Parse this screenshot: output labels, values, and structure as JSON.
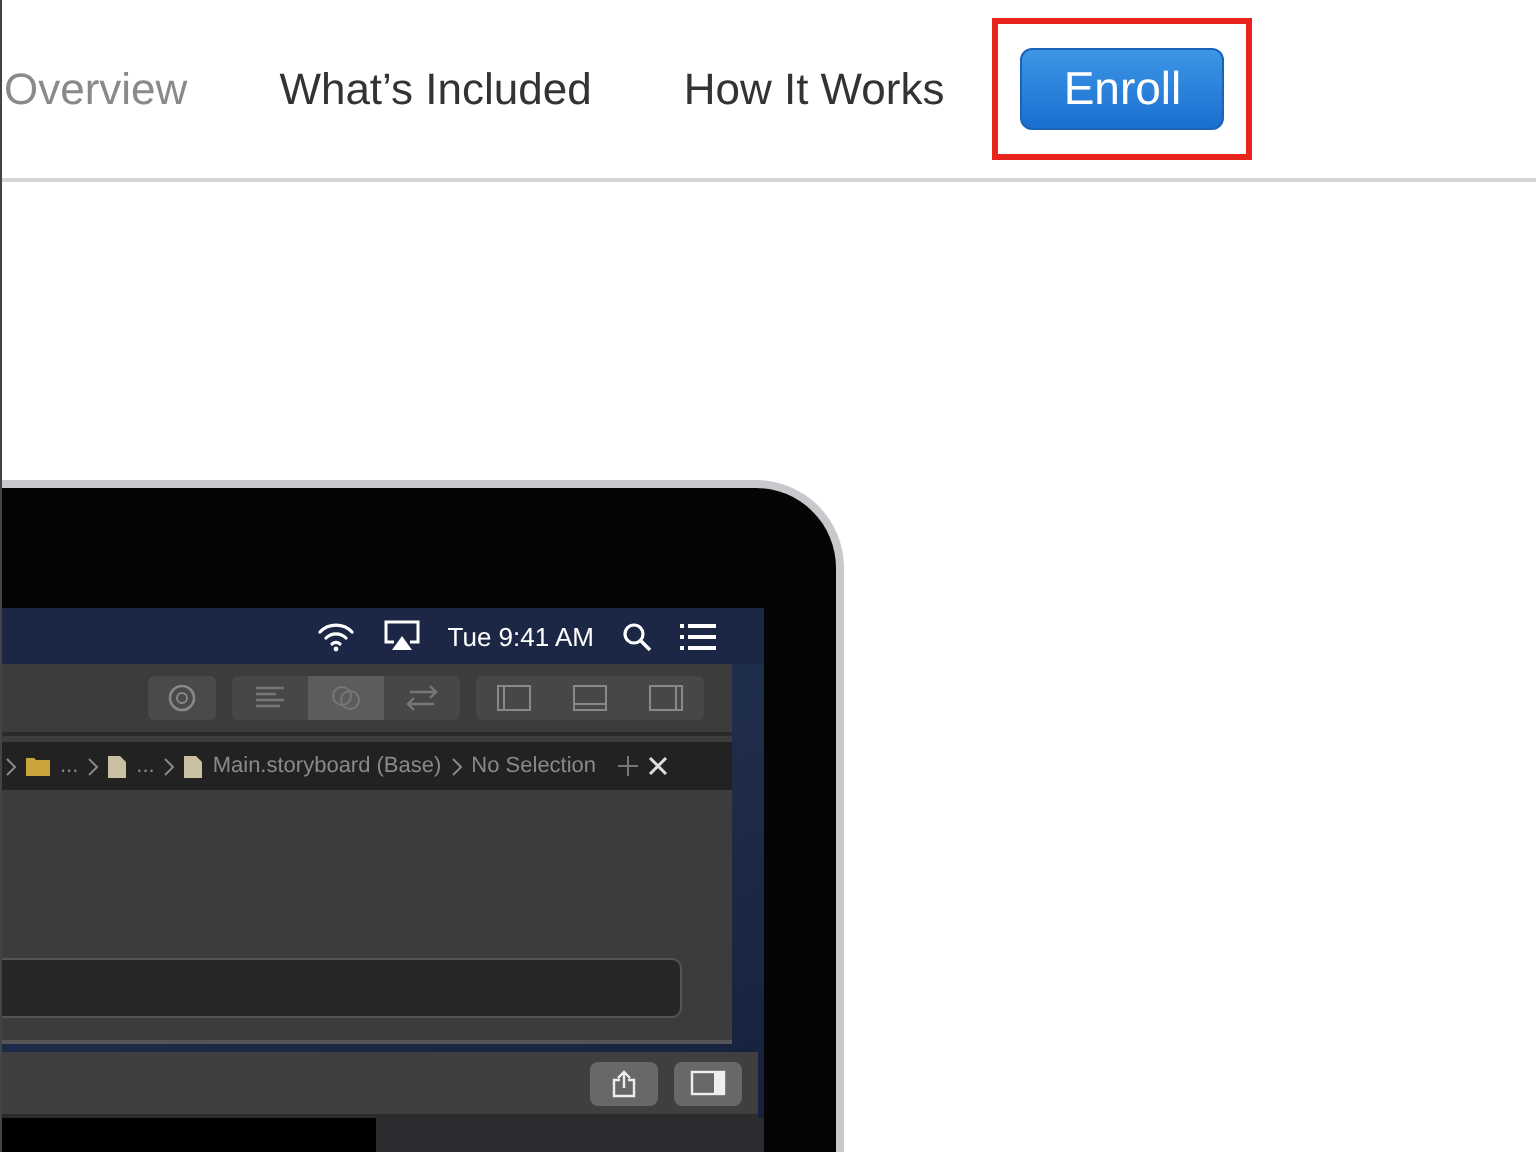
{
  "nav": {
    "items": [
      {
        "label": "Overview",
        "kind": "link",
        "selected": true
      },
      {
        "label": "What’s Included",
        "kind": "link",
        "selected": false
      },
      {
        "label": "How It Works",
        "kind": "link",
        "selected": false
      },
      {
        "label": "Enroll",
        "kind": "button",
        "selected": false,
        "highlighted": true
      }
    ]
  },
  "laptop_screen": {
    "menu_bar": {
      "clock": "Tue 9:41 AM"
    },
    "toolbar": {
      "segments": [
        {
          "kind": "standard-editor",
          "selected": false
        },
        {
          "kind": "assistant-editor",
          "selected": true
        },
        {
          "kind": "version-editor",
          "selected": false
        }
      ]
    },
    "path_bar": {
      "crumbs": [
        {
          "kind": "folder",
          "label": "..."
        },
        {
          "kind": "file",
          "label": "..."
        },
        {
          "kind": "file",
          "label": "Main.storyboard (Base)"
        },
        {
          "kind": "plain",
          "label": "No Selection"
        }
      ]
    }
  }
}
